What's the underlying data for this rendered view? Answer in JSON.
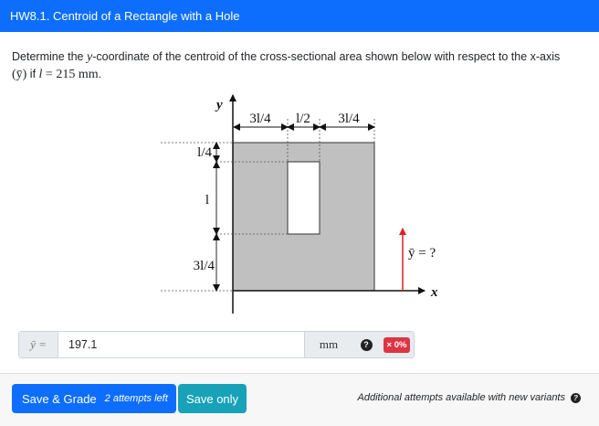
{
  "header": {
    "title": "HW8.1. Centroid of a Rectangle with a Hole"
  },
  "question": {
    "text_1": "Determine the ",
    "var_y": "y",
    "text_2": "-coordinate of the centroid of the cross-sectional area shown below with respect to the x-axis",
    "paren_ybar": "(ȳ)",
    "text_3": " if ",
    "var_l": "l",
    "eq_value": " = 215 mm",
    "period": "."
  },
  "figure": {
    "axis_y_label": "y",
    "axis_x_label": "x",
    "top_dim_left": "3l/4",
    "top_dim_mid": "l/2",
    "top_dim_right": "3l/4",
    "left_dim_top": "l/4",
    "left_dim_mid": "l",
    "left_dim_bottom": "3l/4",
    "ybar_label": "ȳ = ?",
    "colors": {
      "plate": "#c0c0c0",
      "hole": "#ffffff",
      "ybar_arrow": "#e02020"
    }
  },
  "answer": {
    "label": "ȳ =",
    "value": "197.1",
    "unit": "mm",
    "help_icon": "question-circle-icon",
    "badge": "× 0%",
    "badge_color": "#dc3545"
  },
  "footer": {
    "save_grade": "Save & Grade",
    "attempts": "2 attempts left",
    "save_only": "Save only",
    "note": "Additional attempts available with new variants"
  }
}
